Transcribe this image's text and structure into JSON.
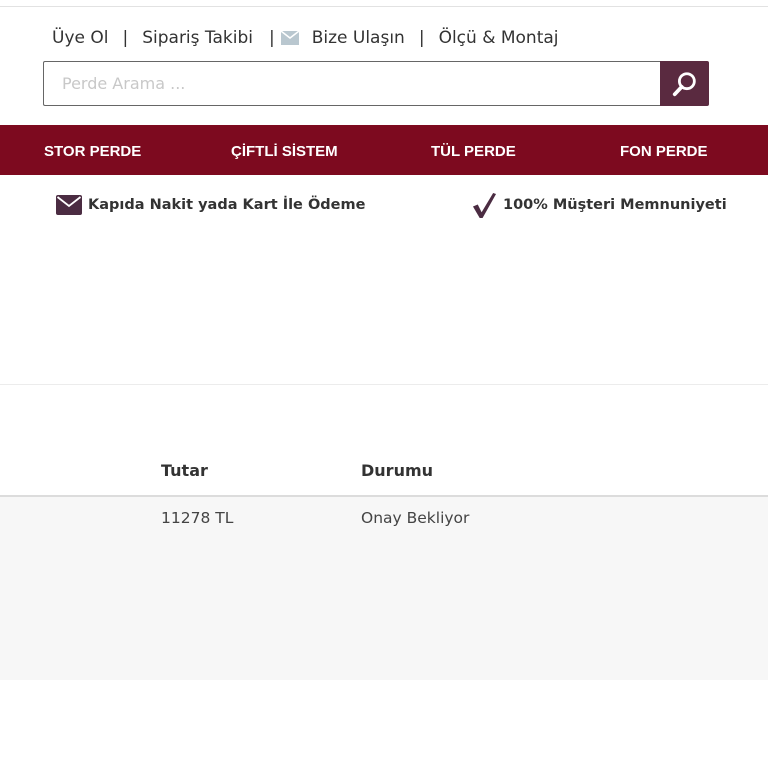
{
  "top_links": {
    "register": "Üye Ol",
    "order_tracking": "Sipariş Takibi",
    "contact": "Bize Ulaşın",
    "measure_install": "Ölçü & Montaj",
    "separator": "|"
  },
  "search": {
    "placeholder": "Perde Arama ...",
    "value": ""
  },
  "nav": {
    "items": [
      "STOR PERDE",
      "ÇİFTLİ SİSTEM",
      "TÜL PERDE",
      "FON PERDE"
    ]
  },
  "features": {
    "payment": "Kapıda Nakit yada Kart İle Ödeme",
    "satisfaction": "100% Müşteri Memnuniyeti"
  },
  "orders_table": {
    "headers": {
      "amount": "Tutar",
      "status": "Durumu"
    },
    "rows": [
      {
        "amount": "11278 TL",
        "status": "Onay Bekliyor"
      }
    ]
  },
  "colors": {
    "navbar": "#7d0a1f",
    "search_button": "#5a2a40",
    "icon_accent": "#4b2c42"
  },
  "icons": {
    "search": "search-icon",
    "contact": "mail-icon",
    "payment": "envelope-icon",
    "satisfaction": "checkmark-icon"
  }
}
